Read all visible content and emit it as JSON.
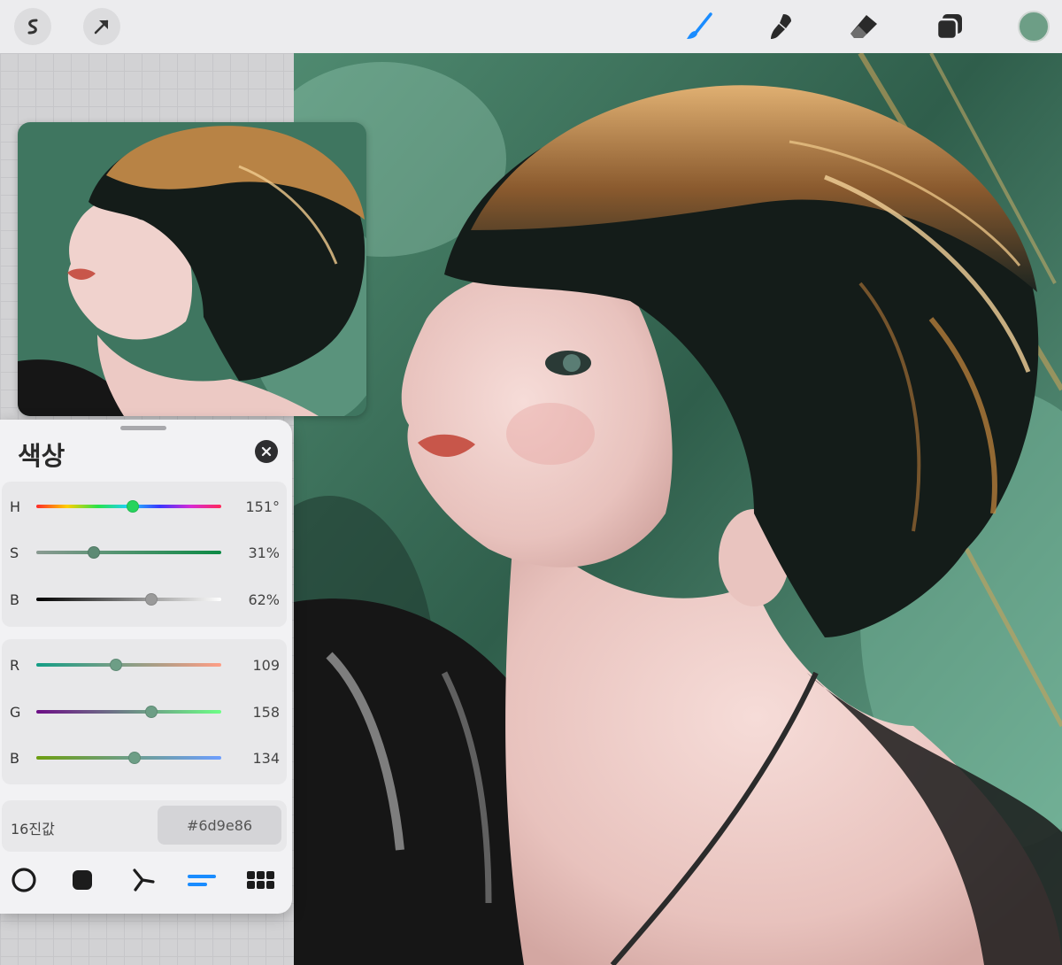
{
  "toolbar": {
    "left_tools": [
      {
        "name": "modify-tool",
        "icon": "s-curve-icon"
      },
      {
        "name": "transform-tool",
        "icon": "arrow-cursor-icon"
      }
    ],
    "right_tools": [
      {
        "name": "brush-tool",
        "icon": "brush-icon",
        "active": true
      },
      {
        "name": "smudge-tool",
        "icon": "smudge-icon"
      },
      {
        "name": "eraser-tool",
        "icon": "eraser-icon"
      },
      {
        "name": "layers-tool",
        "icon": "layers-icon"
      }
    ],
    "current_color": "#6d9e86",
    "active_color": "#1a8cff"
  },
  "color_panel": {
    "title": "색상",
    "hsb": [
      {
        "label": "H",
        "value": "151°",
        "fraction": 0.52
      },
      {
        "label": "S",
        "value": "31%",
        "fraction": 0.31
      },
      {
        "label": "B",
        "value": "62%",
        "fraction": 0.62
      }
    ],
    "rgb": [
      {
        "label": "R",
        "value": "109",
        "fraction": 0.43
      },
      {
        "label": "G",
        "value": "158",
        "fraction": 0.62
      },
      {
        "label": "B",
        "value": "134",
        "fraction": 0.53
      }
    ],
    "hex_label": "16진값",
    "hex_value": "#6d9e86",
    "modes": [
      {
        "name": "disc-mode",
        "icon": "circle-outline-icon"
      },
      {
        "name": "classic-mode",
        "icon": "rounded-square-icon"
      },
      {
        "name": "harmony-mode",
        "icon": "harmony-icon"
      },
      {
        "name": "value-mode",
        "icon": "sliders-lines-icon",
        "active": true
      },
      {
        "name": "palettes-mode",
        "icon": "grid-dots-icon"
      }
    ]
  }
}
